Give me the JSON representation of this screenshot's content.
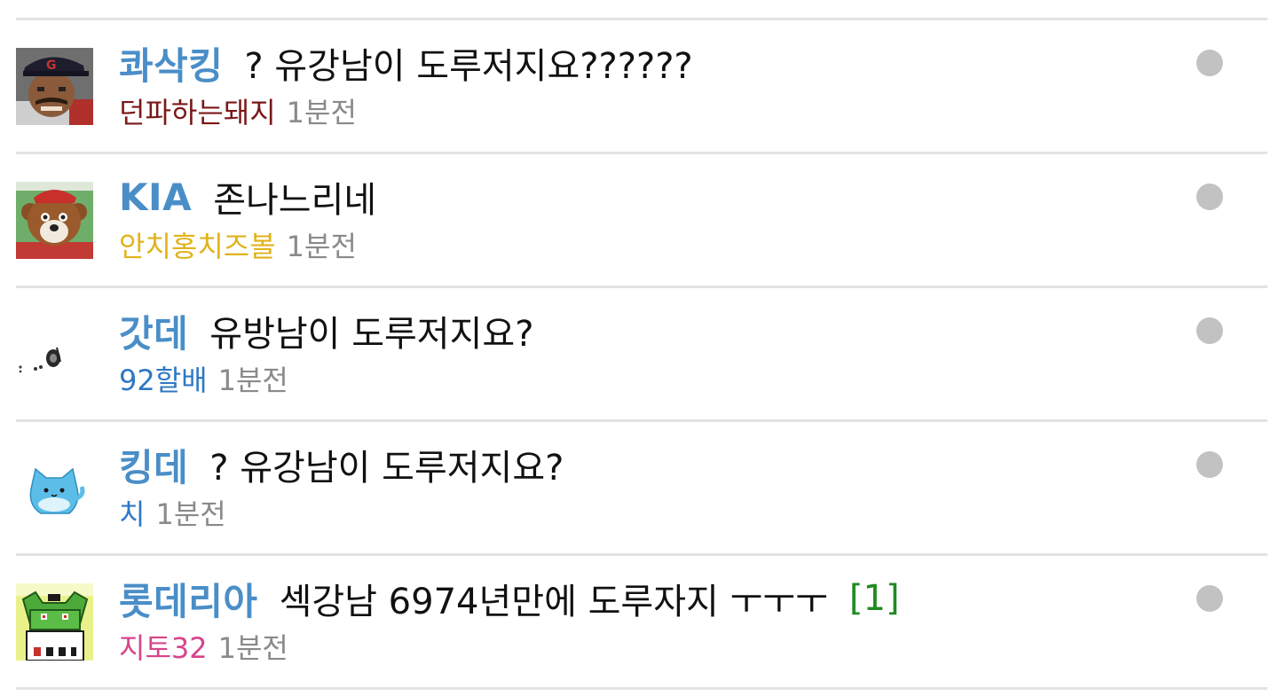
{
  "posts": [
    {
      "team": "콰삭킹",
      "title": "? 유강남이 도루저지요??????",
      "author": "던파하는돼지",
      "author_color": "#7a1818",
      "time": "1분전",
      "comments": "",
      "avatar": "baseball-player-icon"
    },
    {
      "team": "KIA",
      "title": "존나느리네",
      "author": "안치홍치즈볼",
      "author_color": "#e0b31a",
      "time": "1분전",
      "comments": "",
      "avatar": "tiger-mascot-icon"
    },
    {
      "team": "갓데",
      "title": "유방남이 도루저지요?",
      "author": "92할배",
      "author_color": "#2f78c4",
      "time": "1분전",
      "comments": "",
      "avatar": "small-glyph-icon"
    },
    {
      "team": "킹데",
      "title": "? 유강남이 도루저지요?",
      "author": "치",
      "author_color": "#2f78c4",
      "time": "1분전",
      "comments": "",
      "avatar": "blue-cat-icon"
    },
    {
      "team": "롯데리아",
      "title": "섹강남 6974년만에 도루자지 ㅜㅜㅜ",
      "author": "지토32",
      "author_color": "#d6458c",
      "time": "1분전",
      "comments": "[1]",
      "avatar": "green-pixel-character-icon"
    }
  ],
  "colors": {
    "team": "#4a8ec8",
    "time": "#8a8a8a",
    "comment_count": "#1f8a1f",
    "unread_dot": "#c2c2c2",
    "divider": "#e3e3e3"
  }
}
